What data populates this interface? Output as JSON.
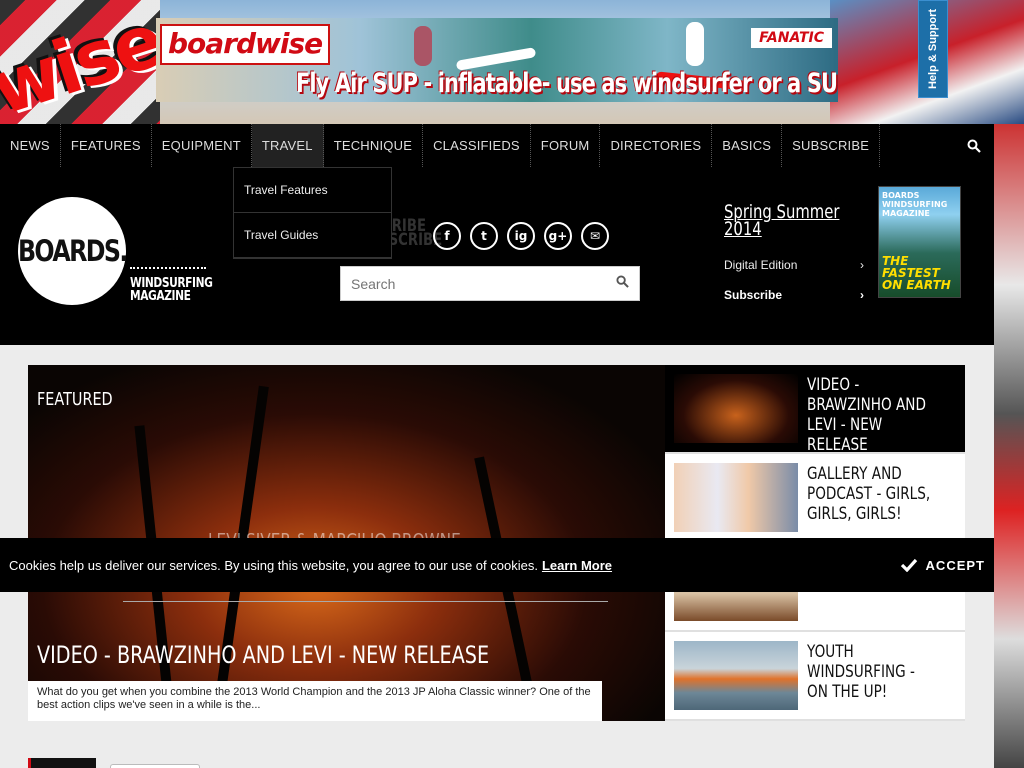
{
  "banner": {
    "brand": "boardwise",
    "partner": "FANATIC",
    "caption": "Fly Air SUP - inflatable- use as windsurfer or a SUP!"
  },
  "help_tab": "Help & Support",
  "nav": {
    "items": [
      "NEWS",
      "FEATURES",
      "EQUIPMENT",
      "TRAVEL",
      "TECHNIQUE",
      "CLASSIFIEDS",
      "FORUM",
      "DIRECTORIES",
      "BASICS",
      "SUBSCRIBE"
    ],
    "active": "TRAVEL",
    "dropdown": [
      "Travel Features",
      "Travel Guides"
    ]
  },
  "header": {
    "logo": "BOARDS.",
    "logo_sub": [
      "WINDSURFING",
      "MAGAZINE"
    ],
    "subscribe_ghost": [
      "SUBSCRIBE",
      "& SUBSCRIBE"
    ],
    "socials": [
      "f",
      "t",
      "ig",
      "g+",
      "✉"
    ],
    "search_placeholder": "Search",
    "issue_title": [
      "Spring Summer",
      "2014"
    ],
    "digital_edition": "Digital Edition",
    "subscribe": "Subscribe",
    "chevron": "›",
    "cover_title": "BOARDS WINDSURFING MAGAZINE",
    "cover_text": [
      "THE",
      "FASTEST",
      "ON EARTH"
    ]
  },
  "feature": {
    "label": "FEATURED",
    "ghost": "LEVI SIVER & MARCILIO BROWNE",
    "title": "VIDEO - BRAWZINHO AND LEVI - NEW RELEASE",
    "excerpt": "What do you get when you combine the 2013 World Champion and the 2013 JP Aloha Classic winner? One of the best action clips we've seen in a while is the..."
  },
  "side_items": [
    {
      "title": "VIDEO - BRAWZINHO AND LEVI - NEW RELEASE"
    },
    {
      "title": "GALLERY AND PODCAST - GIRLS, GIRLS, GIRLS!"
    },
    {
      "title": ""
    },
    {
      "title": "YOUTH WINDSURFING - ON THE UP!"
    }
  ],
  "cookie": {
    "text": "Cookies help us deliver our services. By using this website, you agree to our use of cookies.",
    "link": "Learn More",
    "accept": "ACCEPT"
  }
}
